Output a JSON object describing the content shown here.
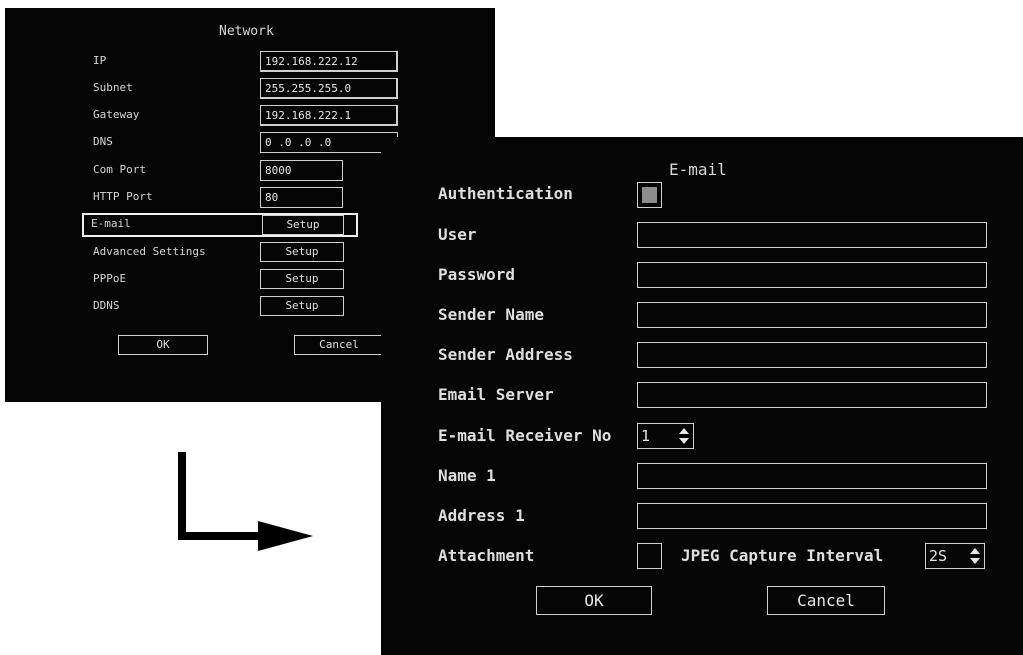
{
  "network": {
    "title": "Network",
    "ip_label": "IP",
    "ip_value": "192.168.222.12",
    "subnet_label": "Subnet",
    "subnet_value": "255.255.255.0",
    "gateway_label": "Gateway",
    "gateway_value": "192.168.222.1",
    "dns_label": "DNS",
    "dns_value": "0 .0 .0 .0",
    "com_port_label": "Com Port",
    "com_port_value": "8000",
    "http_port_label": "HTTP Port",
    "http_port_value": "80",
    "email_label": "E-mail",
    "advanced_label": "Advanced Settings",
    "pppoe_label": "PPPoE",
    "ddns_label": "DDNS",
    "setup_label": "Setup",
    "ok_label": "OK",
    "cancel_label": "Cancel"
  },
  "email": {
    "title": "E-mail",
    "authentication_label": "Authentication",
    "authentication_checked": true,
    "user_label": "User",
    "password_label": "Password",
    "sender_name_label": "Sender Name",
    "sender_address_label": "Sender Address",
    "email_server_label": "Email Server",
    "receiver_no_label": "E-mail Receiver No",
    "receiver_no_value": "1",
    "name1_label": "Name 1",
    "address1_label": "Address 1",
    "attachment_label": "Attachment",
    "attachment_checked": false,
    "jpeg_interval_label": "JPEG Capture Interval",
    "jpeg_interval_value": "2S",
    "ok_label": "OK",
    "cancel_label": "Cancel"
  },
  "colors": {
    "panel_background": "#050505",
    "text": "#e8e8e8",
    "border": "#cfcfcf",
    "checkbox_fill": "#8d8d8d",
    "page_background": "#ffffff"
  }
}
